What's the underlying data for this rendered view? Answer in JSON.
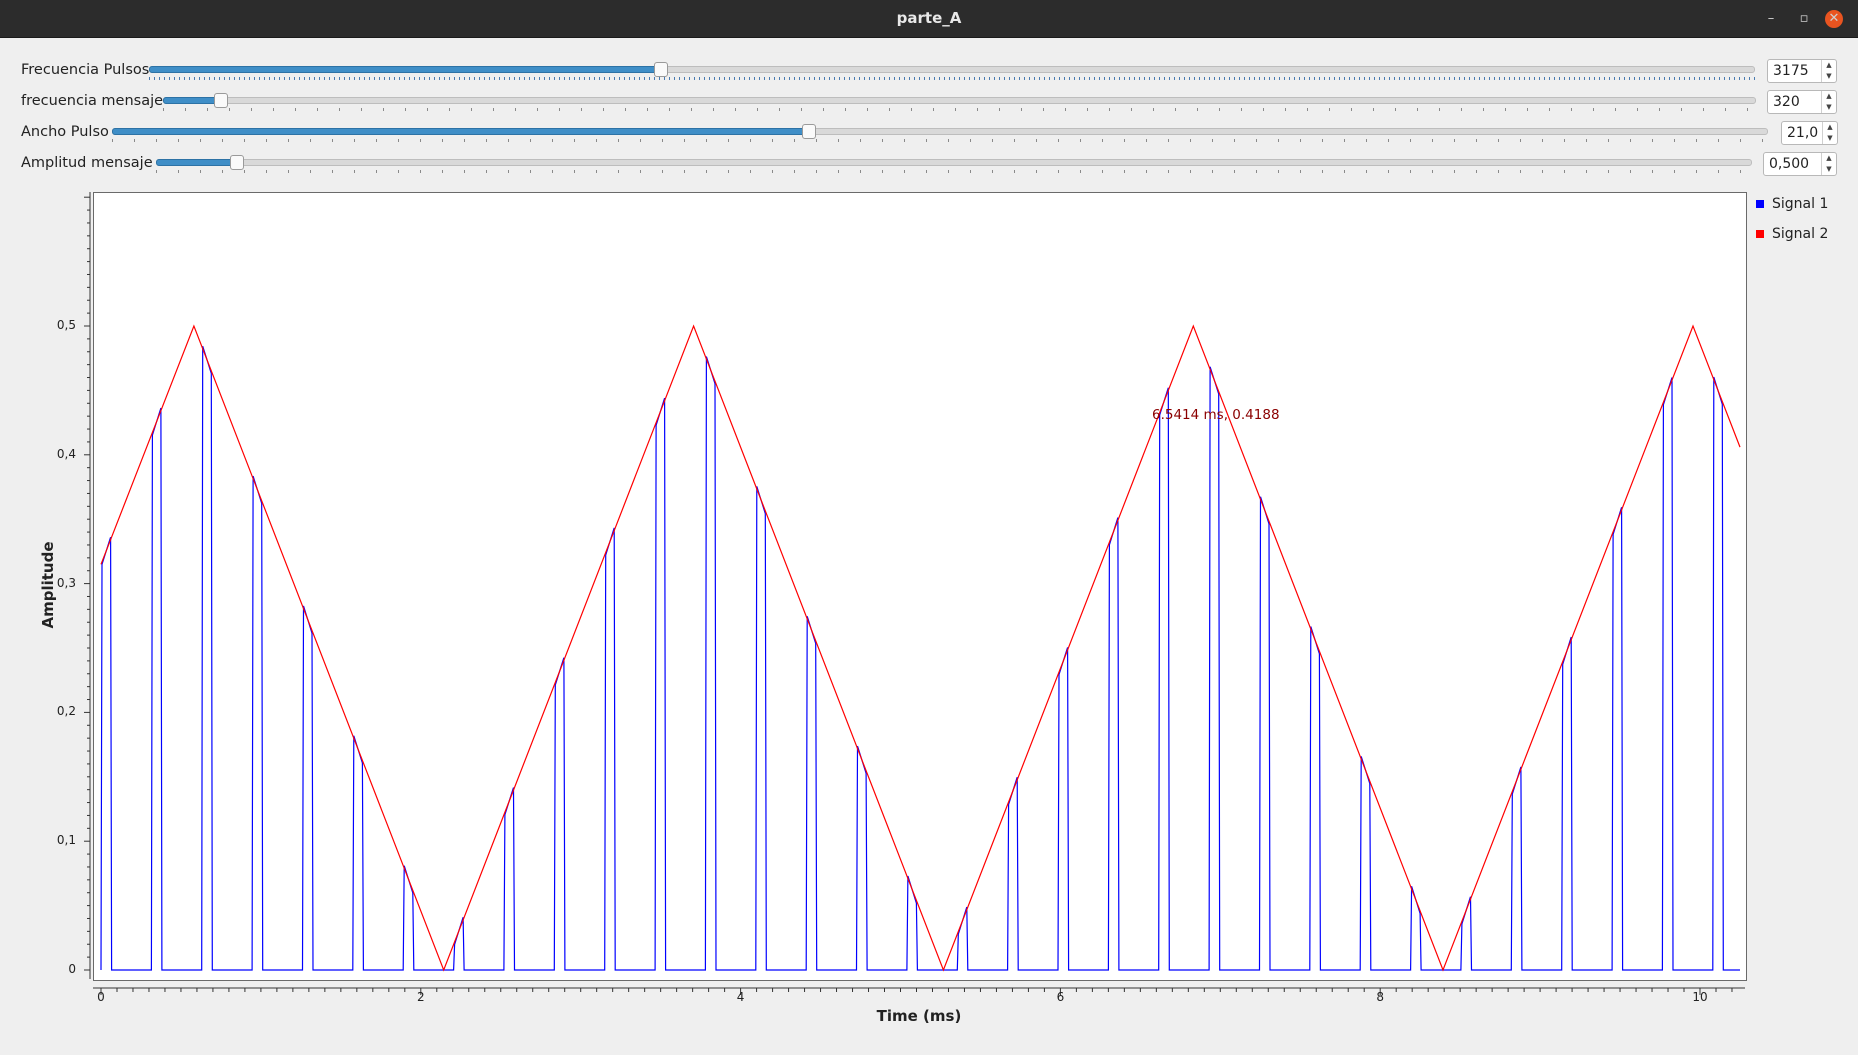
{
  "window": {
    "title": "parte_A",
    "controls": {
      "minimize": "–",
      "maximize": "▫",
      "close": "✕"
    }
  },
  "controls": [
    {
      "label": "Frecuencia Pulsos",
      "value": "3175",
      "slider_fraction": 0.318
    },
    {
      "label": "frecuencia mensaje",
      "value": "320",
      "slider_fraction": 0.036
    },
    {
      "label": "Ancho Pulso",
      "value": "21,0",
      "slider_fraction": 0.42
    },
    {
      "label": "Amplitud mensaje",
      "value": "0,500",
      "slider_fraction": 0.05
    }
  ],
  "legend": [
    {
      "name": "Signal 1",
      "color": "#0000ff"
    },
    {
      "name": "Signal 2",
      "color": "#ff0000"
    }
  ],
  "marker_text": "6.5414 ms, 0.4188",
  "chart_data": {
    "type": "line",
    "xlabel": "Time (ms)",
    "ylabel": "Amplitude",
    "xlim": [
      -0.1,
      10.25
    ],
    "ylim": [
      0,
      0.6
    ],
    "xticks": [
      "0",
      "2",
      "4",
      "6",
      "8",
      "10"
    ],
    "yticks": [
      "0",
      "0,1",
      "0,2",
      "0,3",
      "0,4",
      "0,5"
    ],
    "grid": false,
    "legend_position": "right",
    "series": [
      {
        "name": "Signal 1",
        "color": "#0000ff",
        "kind": "sampled pulses of Signal 2",
        "pulse_period_ms": 0.315,
        "pulse_width_ms": 0.066,
        "first_pulse_ms": 0.0
      },
      {
        "name": "Signal 2",
        "color": "#ff0000",
        "kind": "triangle wave",
        "points": [
          [
            0.0,
            0.315
          ],
          [
            0.581,
            0.5
          ],
          [
            2.143,
            0.0
          ],
          [
            3.706,
            0.5
          ],
          [
            5.268,
            0.0
          ],
          [
            6.831,
            0.5
          ],
          [
            8.393,
            0.0
          ],
          [
            9.956,
            0.5
          ],
          [
            10.25,
            0.406
          ]
        ]
      }
    ]
  }
}
